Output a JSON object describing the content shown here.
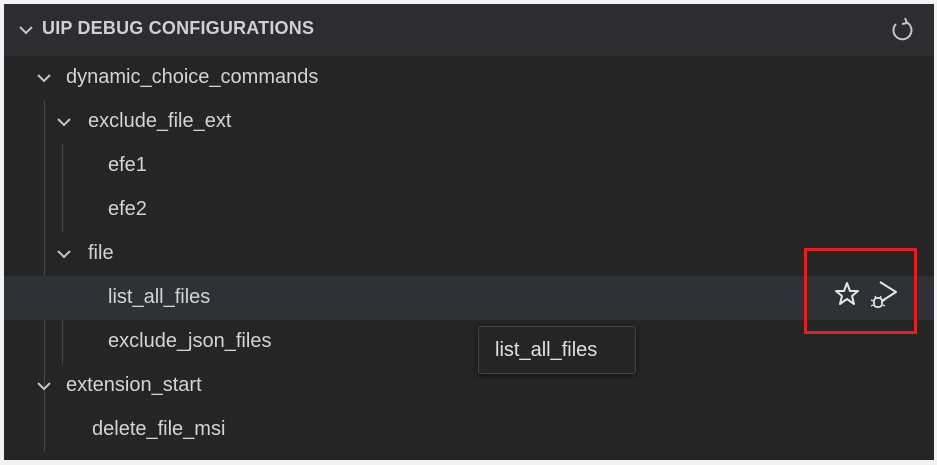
{
  "section": {
    "title": "UIP DEBUG CONFIGURATIONS",
    "refresh_icon": "refresh-icon"
  },
  "tree": {
    "group_dynamic": "dynamic_choice_commands",
    "sub_exclude": "exclude_file_ext",
    "efe1": "efe1",
    "efe2": "efe2",
    "sub_file": "file",
    "list_all_files": "list_all_files",
    "exclude_json_files": "exclude_json_files",
    "group_extension": "extension_start",
    "delete_file_msi": "delete_file_msi",
    "selected_item": "list_all_files"
  },
  "actions": {
    "favorite_icon": "star-icon",
    "debug_icon": "debug-run-icon"
  },
  "tooltip": {
    "text": "list_all_files"
  },
  "colors": {
    "panel_bg": "#252526",
    "selected_bg": "#2f3136",
    "highlight_border": "#e02020",
    "text": "#d4d4d4"
  }
}
